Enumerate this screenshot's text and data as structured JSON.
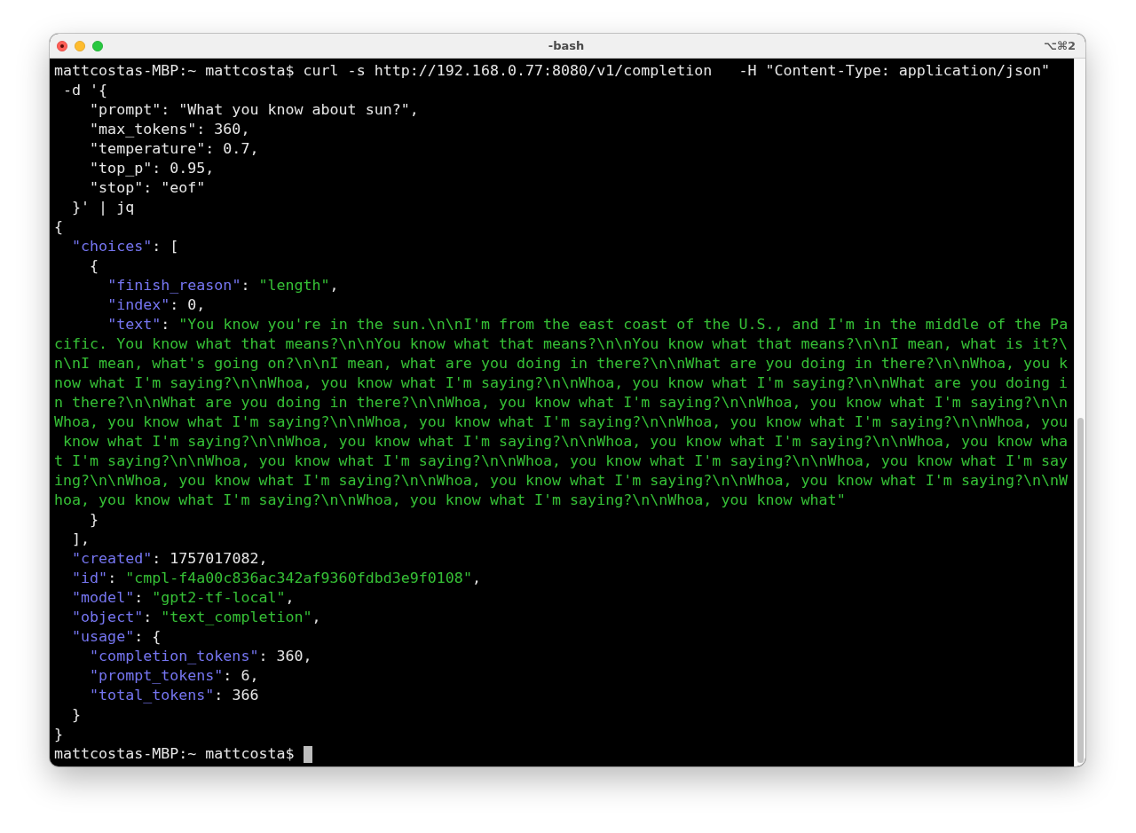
{
  "window": {
    "title": "-bash",
    "shortcut": "⌥⌘2",
    "process_running": true
  },
  "terminal": {
    "lines": [
      {
        "segments": [
          {
            "text": "mattcostas-MBP:~ mattcosta$ curl -s http://192.168.0.77:8080/v1/completion   -H \"Content-Type: application/json\"",
            "kind": "plain"
          }
        ]
      },
      {
        "segments": [
          {
            "text": " -d '{",
            "kind": "plain"
          }
        ]
      },
      {
        "segments": [
          {
            "text": "    \"prompt\": \"What you know about sun?\",",
            "kind": "plain"
          }
        ]
      },
      {
        "segments": [
          {
            "text": "    \"max_tokens\": 360,",
            "kind": "plain"
          }
        ]
      },
      {
        "segments": [
          {
            "text": "    \"temperature\": 0.7,",
            "kind": "plain"
          }
        ]
      },
      {
        "segments": [
          {
            "text": "    \"top_p\": 0.95,",
            "kind": "plain"
          }
        ]
      },
      {
        "segments": [
          {
            "text": "    \"stop\": \"eof\"",
            "kind": "plain"
          }
        ]
      },
      {
        "segments": [
          {
            "text": "  }' | jq",
            "kind": "plain"
          }
        ]
      },
      {
        "segments": [
          {
            "text": "{",
            "kind": "plain"
          }
        ]
      },
      {
        "segments": [
          {
            "text": "  \"choices\"",
            "kind": "key"
          },
          {
            "text": ": [",
            "kind": "plain"
          }
        ]
      },
      {
        "segments": [
          {
            "text": "    {",
            "kind": "plain"
          }
        ]
      },
      {
        "segments": [
          {
            "text": "      \"finish_reason\"",
            "kind": "key"
          },
          {
            "text": ": ",
            "kind": "plain"
          },
          {
            "text": "\"length\"",
            "kind": "string"
          },
          {
            "text": ",",
            "kind": "plain"
          }
        ]
      },
      {
        "segments": [
          {
            "text": "      \"index\"",
            "kind": "key"
          },
          {
            "text": ": 0,",
            "kind": "plain"
          }
        ]
      },
      {
        "segments": [
          {
            "text": "      \"text\"",
            "kind": "key"
          },
          {
            "text": ": ",
            "kind": "plain"
          },
          {
            "text": "\"You know you're in the sun.\\n\\nI'm from the east coast of the U.S., and I'm in the middle of the Pa",
            "kind": "string"
          }
        ]
      },
      {
        "segments": [
          {
            "text": "cific. You know what that means?\\n\\nYou know what that means?\\n\\nYou know what that means?\\n\\nI mean, what is it?\\",
            "kind": "string"
          }
        ]
      },
      {
        "segments": [
          {
            "text": "n\\nI mean, what's going on?\\n\\nI mean, what are you doing in there?\\n\\nWhat are you doing in there?\\n\\nWhoa, you k",
            "kind": "string"
          }
        ]
      },
      {
        "segments": [
          {
            "text": "now what I'm saying?\\n\\nWhoa, you know what I'm saying?\\n\\nWhoa, you know what I'm saying?\\n\\nWhat are you doing i",
            "kind": "string"
          }
        ]
      },
      {
        "segments": [
          {
            "text": "n there?\\n\\nWhat are you doing in there?\\n\\nWhoa, you know what I'm saying?\\n\\nWhoa, you know what I'm saying?\\n\\n",
            "kind": "string"
          }
        ]
      },
      {
        "segments": [
          {
            "text": "Whoa, you know what I'm saying?\\n\\nWhoa, you know what I'm saying?\\n\\nWhoa, you know what I'm saying?\\n\\nWhoa, you",
            "kind": "string"
          }
        ]
      },
      {
        "segments": [
          {
            "text": " know what I'm saying?\\n\\nWhoa, you know what I'm saying?\\n\\nWhoa, you know what I'm saying?\\n\\nWhoa, you know wha",
            "kind": "string"
          }
        ]
      },
      {
        "segments": [
          {
            "text": "t I'm saying?\\n\\nWhoa, you know what I'm saying?\\n\\nWhoa, you know what I'm saying?\\n\\nWhoa, you know what I'm say",
            "kind": "string"
          }
        ]
      },
      {
        "segments": [
          {
            "text": "ing?\\n\\nWhoa, you know what I'm saying?\\n\\nWhoa, you know what I'm saying?\\n\\nWhoa, you know what I'm saying?\\n\\nW",
            "kind": "string"
          }
        ]
      },
      {
        "segments": [
          {
            "text": "hoa, you know what I'm saying?\\n\\nWhoa, you know what I'm saying?\\n\\nWhoa, you know what\"",
            "kind": "string"
          }
        ]
      },
      {
        "segments": [
          {
            "text": "    }",
            "kind": "plain"
          }
        ]
      },
      {
        "segments": [
          {
            "text": "  ],",
            "kind": "plain"
          }
        ]
      },
      {
        "segments": [
          {
            "text": "  \"created\"",
            "kind": "key"
          },
          {
            "text": ": 1757017082,",
            "kind": "plain"
          }
        ]
      },
      {
        "segments": [
          {
            "text": "  \"id\"",
            "kind": "key"
          },
          {
            "text": ": ",
            "kind": "plain"
          },
          {
            "text": "\"cmpl-f4a00c836ac342af9360fdbd3e9f0108\"",
            "kind": "string"
          },
          {
            "text": ",",
            "kind": "plain"
          }
        ]
      },
      {
        "segments": [
          {
            "text": "  \"model\"",
            "kind": "key"
          },
          {
            "text": ": ",
            "kind": "plain"
          },
          {
            "text": "\"gpt2-tf-local\"",
            "kind": "string"
          },
          {
            "text": ",",
            "kind": "plain"
          }
        ]
      },
      {
        "segments": [
          {
            "text": "  \"object\"",
            "kind": "key"
          },
          {
            "text": ": ",
            "kind": "plain"
          },
          {
            "text": "\"text_completion\"",
            "kind": "string"
          },
          {
            "text": ",",
            "kind": "plain"
          }
        ]
      },
      {
        "segments": [
          {
            "text": "  \"usage\"",
            "kind": "key"
          },
          {
            "text": ": {",
            "kind": "plain"
          }
        ]
      },
      {
        "segments": [
          {
            "text": "    \"completion_tokens\"",
            "kind": "key"
          },
          {
            "text": ": 360,",
            "kind": "plain"
          }
        ]
      },
      {
        "segments": [
          {
            "text": "    \"prompt_tokens\"",
            "kind": "key"
          },
          {
            "text": ": 6,",
            "kind": "plain"
          }
        ]
      },
      {
        "segments": [
          {
            "text": "    \"total_tokens\"",
            "kind": "key"
          },
          {
            "text": ": 366",
            "kind": "plain"
          }
        ]
      },
      {
        "segments": [
          {
            "text": "  }",
            "kind": "plain"
          }
        ]
      },
      {
        "segments": [
          {
            "text": "}",
            "kind": "plain"
          }
        ]
      }
    ],
    "prompt": "mattcostas-MBP:~ mattcosta$",
    "cursor": true
  }
}
